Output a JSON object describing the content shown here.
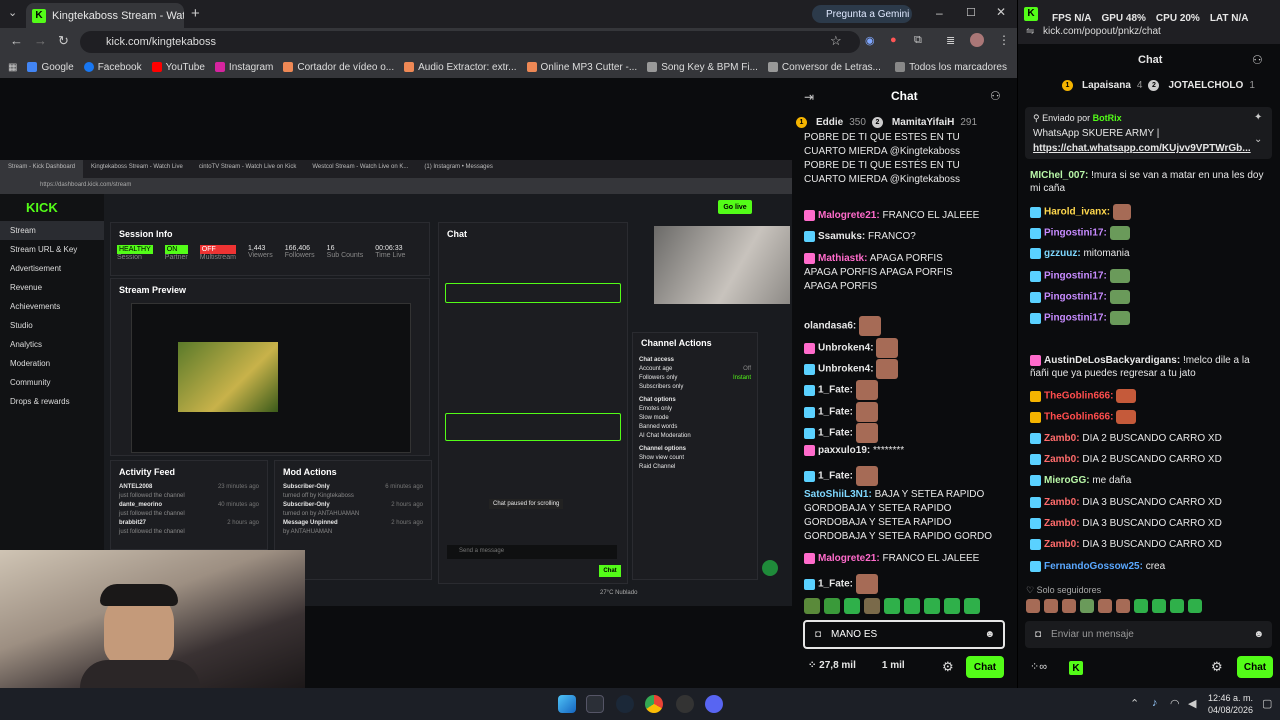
{
  "browser": {
    "tab_title": "Kingtekaboss Stream - Watch",
    "gemini_label": "Pregunta a Gemini",
    "url": "kick.com/kingtekaboss",
    "bookmarks": [
      "Google",
      "Facebook",
      "YouTube",
      "Instagram",
      "Cortador de vídeo o...",
      "Audio Extractor: extr...",
      "Online MP3 Cutter -...",
      "Song Key & BPM Fi...",
      "Conversor de Letras..."
    ],
    "all_bookmarks": "Todos los marcadores"
  },
  "stream": {
    "inner_tabs": [
      "Stream - Kick Dashboard",
      "Kingtekaboss Stream - Watch Live",
      "cintoTV Stream - Watch Live on Kick",
      "Westcol Stream - Watch Live on K...",
      "(1) Instagram • Messages"
    ],
    "inner_url": "https://dashboard.kick.com/stream",
    "go_live": "Go live",
    "sidebar": [
      "Stream",
      "Stream URL & Key",
      "Advertisement",
      "Revenue",
      "Achievements",
      "Studio",
      "Analytics",
      "Moderation",
      "Community",
      "Drops & rewards"
    ],
    "session_title": "Session Info",
    "session_stats": [
      {
        "v": "HEALTHY",
        "l": "Session"
      },
      {
        "v": "ON",
        "l": "Partner"
      },
      {
        "v": "OFF",
        "l": "Multistream"
      },
      {
        "v": "1,443",
        "l": "Viewers"
      },
      {
        "v": "166,406",
        "l": "Followers"
      },
      {
        "v": "16",
        "l": "Sub Counts"
      },
      {
        "v": "00:06:33",
        "l": "Time Live"
      }
    ],
    "preview_title": "Stream Preview",
    "activity_title": "Activity Feed",
    "activity": [
      {
        "n": "ANTEL2008",
        "s": "just followed the channel",
        "t": "23 minutes ago"
      },
      {
        "n": "dante_meorino",
        "s": "just followed the channel",
        "t": "40 minutes ago"
      },
      {
        "n": "brabbit27",
        "s": "just followed the channel",
        "t": "2 hours ago"
      }
    ],
    "mod_title": "Mod Actions",
    "mod": [
      {
        "n": "Subscriber-Only",
        "s": "turned off by Kingtekaboss",
        "t": "6 minutes ago"
      },
      {
        "n": "Subscriber-Only",
        "s": "turned on by ANTAHUAMAN",
        "t": "2 hours ago"
      },
      {
        "n": "Message Unpinned",
        "s": "by ANTAHUAMAN",
        "t": "2 hours ago"
      }
    ],
    "inner_chat_title": "Chat",
    "inner_chat_paused": "Chat paused for scrolling",
    "inner_chat_placeholder": "Send a message",
    "inner_chat_btn": "Chat",
    "channel_actions_title": "Channel Actions",
    "chat_access": "Chat access",
    "access_items": [
      {
        "l": "Account age",
        "v": "Off"
      },
      {
        "l": "Followers only",
        "v": "Instant"
      },
      {
        "l": "Subscribers only",
        "v": ""
      }
    ],
    "chat_options": "Chat options",
    "option_items": [
      "Emotes only",
      "Slow mode",
      "Banned words",
      "AI Chat Moderation"
    ],
    "channel_options": "Channel options",
    "channel_items": [
      "Show view count",
      "Raid Channel"
    ]
  },
  "right_chat": {
    "title": "Chat",
    "top": [
      {
        "n": "Eddie",
        "v": "350"
      },
      {
        "n": "MamitaYifaiH",
        "v": "291"
      }
    ],
    "messages": [
      {
        "u": "",
        "c": "#e8e8e8",
        "t": "POBRE DE TI QUE ESTES EN TU CUARTO MIERDA @Kingtekaboss"
      },
      {
        "u": "",
        "c": "#e8e8e8",
        "t": "POBRE DE TI QUE ESTÉS EN TU CUARTO MIERDA @Kingtekaboss"
      },
      {
        "u": "Malogrete21:",
        "c": "#ff6bcb",
        "t": "FRANCO EL JALEEE"
      },
      {
        "u": "Ssamuks:",
        "c": "#ffffff",
        "t": "FRANCO?"
      },
      {
        "u": "Mathiastk:",
        "c": "#ff6bcb",
        "t": "APAGA PORFIS APAGA PORFIS APAGA PORFIS APAGA PORFIS"
      },
      {
        "u": "olandasa6:",
        "c": "#ffffff",
        "t": ""
      },
      {
        "u": "Unbroken4:",
        "c": "#ffffff",
        "t": ""
      },
      {
        "u": "Unbroken4:",
        "c": "#ffffff",
        "t": ""
      },
      {
        "u": "1_Fate:",
        "c": "#ffffff",
        "t": ""
      },
      {
        "u": "1_Fate:",
        "c": "#ffffff",
        "t": ""
      },
      {
        "u": "1_Fate:",
        "c": "#ffffff",
        "t": ""
      },
      {
        "u": "paxxulo19:",
        "c": "#ffffff",
        "t": "********"
      },
      {
        "u": "1_Fate:",
        "c": "#ffffff",
        "t": ""
      },
      {
        "u": "SatoShiiL3N1:",
        "c": "#7fd8ff",
        "t": "BAJA Y SETEA RAPIDO GORDOBAJA Y SETEA RAPIDO GORDOBAJA Y SETEA RAPIDO GORDOBAJA Y SETEA RAPIDO GORDO"
      },
      {
        "u": "Malogrete21:",
        "c": "#ff6bcb",
        "t": "FRANCO EL JALEEE"
      },
      {
        "u": "1_Fate:",
        "c": "#ffffff",
        "t": ""
      }
    ],
    "input_value": "MANO ES",
    "viewers": "27,8 mil",
    "followers": "1 mil",
    "send": "Chat"
  },
  "popout": {
    "perf": {
      "fps": "FPS N/A",
      "gpu": "GPU 48%",
      "cpu": "CPU 20%",
      "lat": "LAT N/A"
    },
    "url": "kick.com/popout/pnkz/chat",
    "title": "Chat",
    "top": [
      {
        "n": "Lapaisana",
        "v": "4"
      },
      {
        "n": "JOTAELCHOLO",
        "v": "1"
      }
    ],
    "pinned_by": "Enviado por",
    "pinned_user": "BotRix",
    "pinned_text": "WhatsApp SKUERE ARMY |",
    "pinned_link": "https://chat.whatsapp.com/KUjvv9VPTWrGb...",
    "messages": [
      {
        "u": "MIChel_007:",
        "c": "#b9f7a8",
        "t": "!mura si se van a matar en una les doy mi caña"
      },
      {
        "u": "Harold_ivanx:",
        "c": "#ffd84d",
        "t": ""
      },
      {
        "u": "gzzuuz:",
        "c": "#7fd8ff",
        "t": "mitomania"
      },
      {
        "u": "Pingostini17:",
        "c": "#c78bff",
        "t": ""
      },
      {
        "u": "Pingostini17:",
        "c": "#c78bff",
        "t": ""
      },
      {
        "u": "Pingostini17:",
        "c": "#c78bff",
        "t": ""
      },
      {
        "u": "Pingostini17:",
        "c": "#c78bff",
        "t": ""
      },
      {
        "u": "AustinDeLosBackyardigans:",
        "c": "#ffffff",
        "t": "!melco dile a la ñañi que ya puedes regresar a tu jato"
      },
      {
        "u": "TheGoblin666:",
        "c": "#ff4d4d",
        "t": ""
      },
      {
        "u": "TheGoblin666:",
        "c": "#ff4d4d",
        "t": ""
      },
      {
        "u": "Zamb0:",
        "c": "#ff6b6b",
        "t": "DIA 2 BUSCANDO CARRO XD"
      },
      {
        "u": "Zamb0:",
        "c": "#ff6b6b",
        "t": "DIA 2 BUSCANDO CARRO XD"
      },
      {
        "u": "MieroGG:",
        "c": "#b9f7a8",
        "t": "me daña"
      },
      {
        "u": "Zamb0:",
        "c": "#ff6b6b",
        "t": "DIA 3 BUSCANDO CARRO XD"
      },
      {
        "u": "Zamb0:",
        "c": "#ff6b6b",
        "t": "DIA 3 BUSCANDO CARRO XD"
      },
      {
        "u": "Zamb0:",
        "c": "#ff6b6b",
        "t": "DIA 3 BUSCANDO CARRO XD"
      },
      {
        "u": "FernandoGossow25:",
        "c": "#5aa8ff",
        "t": "crea"
      }
    ],
    "followers_only": "Solo seguidores",
    "placeholder": "Enviar un mensaje",
    "send": "Chat"
  },
  "taskbar": {
    "time": "12:46 a. m.",
    "date": "04/08/2026",
    "weather": "27°C Nublado"
  },
  "colors": {
    "kick_green": "#53fc18",
    "bg": "#0b0c0e"
  }
}
